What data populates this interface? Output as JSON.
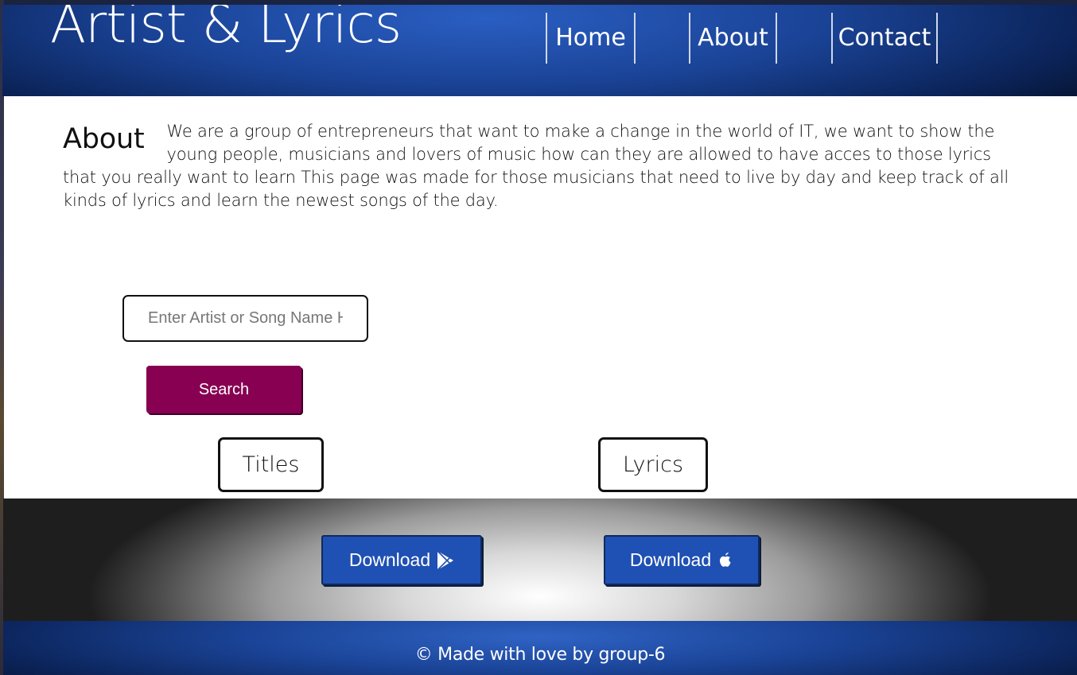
{
  "header": {
    "logo": "Artist & Lyrics",
    "nav": [
      {
        "label": "Home"
      },
      {
        "label": "About"
      },
      {
        "label": "Contact"
      }
    ]
  },
  "about": {
    "title": "About",
    "text": "We are a group of entrepreneurs that want to make a change in the world of IT, we want to show the young people, musicians and lovers of music how can they are allowed to have acces to those lyrics that you really want to learn This page was made for those musicians that need to live by day and keep track of all kinds of lyrics and learn the newest songs of the day."
  },
  "search": {
    "placeholder": "Enter Artist or Song Name Here",
    "value": "",
    "button_label": "Search"
  },
  "results": {
    "titles_label": "Titles",
    "lyrics_label": "Lyrics"
  },
  "downloads": [
    {
      "label": "Download",
      "icon": "google-play-icon"
    },
    {
      "label": "Download",
      "icon": "apple-icon"
    }
  ],
  "footer": {
    "text": "© Made with love by group-6"
  },
  "colors": {
    "header_blue": "#1a4396",
    "search_button": "#870052",
    "download_button": "#1f50b3"
  }
}
